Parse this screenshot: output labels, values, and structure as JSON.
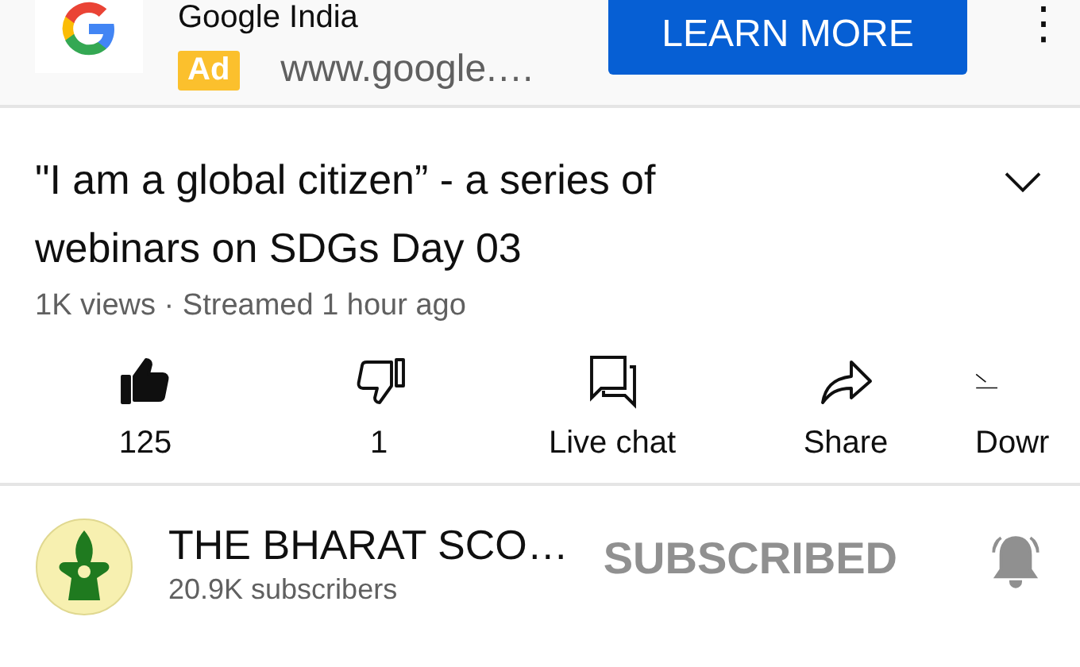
{
  "ad": {
    "title": "Google India",
    "badge": "Ad",
    "url": "www.google.…",
    "button": "LEARN MORE",
    "menu": "⋮"
  },
  "video": {
    "title": "\"I am a global citizen” - a series of webinars on SDGs Day 03",
    "meta": "1K views · Streamed 1 hour ago",
    "expanded": false
  },
  "actions": [
    {
      "kind": "like",
      "label": "125",
      "selected": true
    },
    {
      "kind": "dislike",
      "label": "1",
      "selected": false
    },
    {
      "kind": "chat",
      "label": "Live chat"
    },
    {
      "kind": "share",
      "label": "Share"
    },
    {
      "kind": "download",
      "label": "Dowr"
    }
  ],
  "channel": {
    "name": "THE BHARAT SCO…",
    "subscribers": "20.9K subscribers",
    "button": "SUBSCRIBED",
    "subscribed": true
  }
}
